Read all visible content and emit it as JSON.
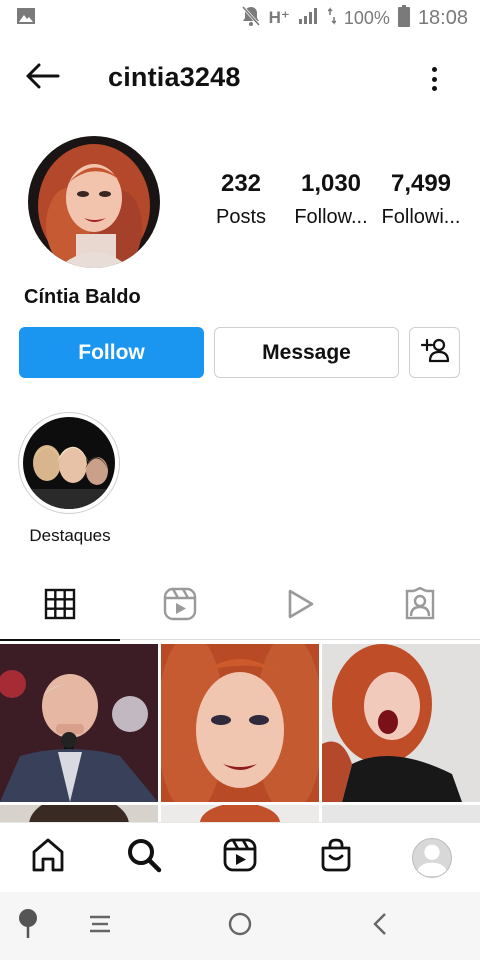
{
  "status_bar": {
    "network": "H⁺",
    "battery_percent": "100%",
    "time": "18:08"
  },
  "header": {
    "username": "cintia3248",
    "back_icon": "arrow-left-icon",
    "menu_icon": "more-vertical-icon"
  },
  "profile": {
    "full_name": "Cíntia Baldo",
    "stats": [
      {
        "value": "232",
        "label": "Posts"
      },
      {
        "value": "1,030",
        "label": "Follow..."
      },
      {
        "value": "7,499",
        "label": "Followi..."
      }
    ]
  },
  "actions": {
    "follow_label": "Follow",
    "message_label": "Message",
    "suggest_icon": "add-person-icon"
  },
  "highlights": [
    {
      "label": "Destaques"
    }
  ],
  "tabs": [
    {
      "icon": "grid-icon",
      "active": true
    },
    {
      "icon": "reels-icon",
      "active": false
    },
    {
      "icon": "video-play-icon",
      "active": false
    },
    {
      "icon": "tagged-person-icon",
      "active": false
    }
  ],
  "bottom_nav": [
    {
      "icon": "home-icon"
    },
    {
      "icon": "search-icon"
    },
    {
      "icon": "reels-icon"
    },
    {
      "icon": "shop-icon"
    },
    {
      "icon": "profile-avatar-icon"
    }
  ],
  "system_nav": [
    {
      "icon": "assistant-pin-icon"
    },
    {
      "icon": "recent-apps-icon"
    },
    {
      "icon": "home-circle-icon"
    },
    {
      "icon": "back-chevron-icon"
    }
  ],
  "colors": {
    "follow_blue": "#1a96f0",
    "hair_red": "#c2502a",
    "status_gray": "#7a7a7a"
  }
}
